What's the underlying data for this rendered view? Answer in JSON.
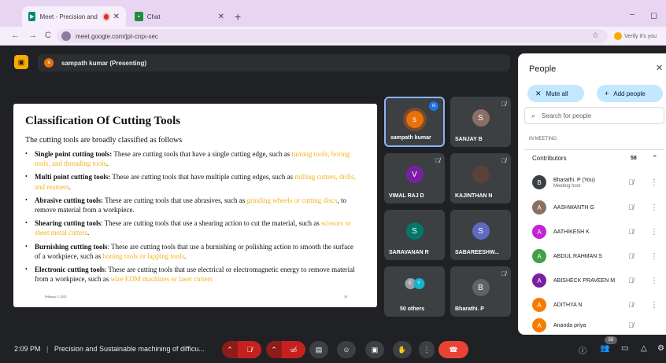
{
  "browser": {
    "tabs": [
      {
        "title": "Meet - Precision and Susta",
        "close": "✕"
      },
      {
        "title": "Chat",
        "close": "✕"
      }
    ],
    "new_tab": "+",
    "url": "meet.google.com/jpt-crqx-xec",
    "verify_label": "Verify it's you",
    "icons": {
      "back": "←",
      "forward": "→",
      "reload": "C",
      "star": "☆",
      "minimize": "−",
      "restore": "◻"
    }
  },
  "meet": {
    "presenting_label": "sampath kumar (Presenting)",
    "presenter_initial": "s",
    "slide": {
      "title": "Classification Of Cutting Tools",
      "intro": "The cutting tools are broadly classified as follows",
      "bullets": [
        {
          "term": "Single point cutting tools:",
          "text": " These are cutting tools that have a single cutting edge, such as ",
          "highlight": "turning tools, boring tools, and threading tools",
          "end": "."
        },
        {
          "term": "Multi point cutting tools:",
          "text": " These are cutting tools that have multiple cutting edges, such as ",
          "highlight": "milling cutters, drills, and reamers",
          "end": "."
        },
        {
          "term": "Abrasive cutting tools:",
          "text": " These are cutting tools that use abrasives, such as ",
          "highlight": "grinding wheels or cutting discs",
          "end": ", to remove material from a workpiece."
        },
        {
          "term": "Shearing cutting tools",
          "text": ": These are cutting tools that use a shearing action to cut the material, such as ",
          "highlight": "scissors or sheet metal cutters",
          "end": "."
        },
        {
          "term": "Burnishing cutting tools",
          "text": ": These are cutting tools that use a burnishing or polishing action to smooth the surface of a workpiece, such as ",
          "highlight": "honing tools or lapping tools",
          "end": "."
        },
        {
          "term": "Electronic cutting tools",
          "text": ": These are cutting tools that use electrical or electromagnetic energy to remove material from a workpiece, such as ",
          "highlight": "wire EDM machines or laser cutters",
          "end": ""
        }
      ],
      "footer_date": "February 5, 2025",
      "page_number": "18"
    },
    "tiles": [
      {
        "name": "sampath kumar",
        "initial": "s",
        "color": "#e8710a"
      },
      {
        "name": "SANJAY B",
        "initial": "S",
        "color": "#8d6e63"
      },
      {
        "name": "VIMAL RAJ D",
        "initial": "V",
        "color": "#7b1fa2"
      },
      {
        "name": "KAJINTHAN N",
        "initial": "",
        "color": "#5d4037"
      },
      {
        "name": "SARAVANAN R",
        "initial": "S",
        "color": "#00796b"
      },
      {
        "name": "SABAREESHW...",
        "initial": "S",
        "color": "#5c6bc0"
      },
      {
        "name": "50 others",
        "initial": "",
        "color": "#3c4043"
      },
      {
        "name": "Bharathi. P",
        "initial": "B",
        "color": "#5f6368"
      }
    ],
    "others_avatars": [
      {
        "initial": "E",
        "color": "#9aa0a6"
      },
      {
        "initial": "Y",
        "color": "#12b5cb"
      }
    ]
  },
  "people_panel": {
    "title": "People",
    "close": "✕",
    "mute_all": "Mute all",
    "add_people": "Add people",
    "search_placeholder": "Search for people",
    "section_label": "IN MEETING",
    "contributors_label": "Contributors",
    "contributors_count": "58",
    "people": [
      {
        "name": "Bharathi. P (You)",
        "sub": "Meeting host",
        "initial": "B",
        "color": "#3c4043"
      },
      {
        "name": "AASHWANTH G",
        "sub": "",
        "initial": "A",
        "color": "#8d6e63"
      },
      {
        "name": "AATHIKESH K",
        "sub": "",
        "initial": "A",
        "color": "#c026d3"
      },
      {
        "name": "ABDUL RAHMAN S",
        "sub": "",
        "initial": "A",
        "color": "#43a047"
      },
      {
        "name": "ABISHECK PRAVEEN M",
        "sub": "",
        "initial": "A",
        "color": "#7b1fa2"
      },
      {
        "name": "ADITHYA N",
        "sub": "",
        "initial": "A",
        "color": "#f57c00"
      },
      {
        "name": "Ananda priya",
        "sub": "",
        "initial": "A",
        "color": "#f57c00"
      }
    ]
  },
  "bottom_bar": {
    "time": "2:09 PM",
    "separator": "|",
    "meeting_title": "Precision and Sustainable machining of difficu...",
    "people_count": "58"
  }
}
